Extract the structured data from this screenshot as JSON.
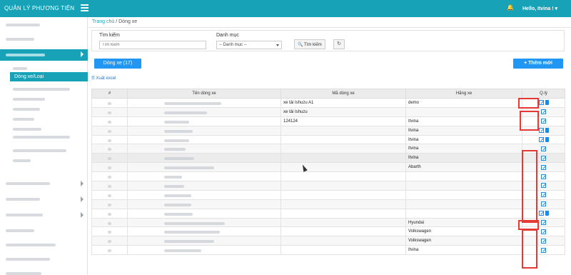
{
  "header": {
    "title": "QUẢN LÝ PHƯƠNG TIỆN",
    "greeting": "Hello, Itvina !"
  },
  "sidebar": {
    "active_sub_label": "Dòng xe/Loại"
  },
  "breadcrumb": {
    "home": "Trang chủ",
    "separator": "/",
    "current": "Dòng xe"
  },
  "filter": {
    "search_label": "Tìm kiếm",
    "search_placeholder": "Tìm kiếm",
    "category_label": "Danh mục",
    "category_selected": "-- Danh mục --",
    "search_button": "Tìm kiếm"
  },
  "toolbar": {
    "tab_label": "Dòng xe (17)",
    "add_button": "+ Thêm mới",
    "export_label": "Xuất excel"
  },
  "table": {
    "headers": [
      "#",
      "Tên dòng xe",
      "Mã dòng xe",
      "Hãng xe",
      "Q.lý"
    ],
    "rows": [
      {
        "code": "xe tải Ishuzu A1",
        "brand": "demo",
        "actions": "edit-delete"
      },
      {
        "code": "xe tải Ishuzu",
        "brand": "",
        "actions": "edit"
      },
      {
        "code": "124124",
        "brand": "Itvina",
        "actions": "edit"
      },
      {
        "code": "",
        "brand": "Itvina",
        "actions": "edit-delete"
      },
      {
        "code": "",
        "brand": "Itvina",
        "actions": "edit-delete"
      },
      {
        "code": "",
        "brand": "Itvina",
        "actions": "edit"
      },
      {
        "code": "",
        "brand": "Itvina",
        "actions": "edit"
      },
      {
        "code": "",
        "brand": "Abarth",
        "actions": "edit"
      },
      {
        "code": "",
        "brand": "",
        "actions": "edit"
      },
      {
        "code": "",
        "brand": "",
        "actions": "edit"
      },
      {
        "code": "",
        "brand": "",
        "actions": "edit"
      },
      {
        "code": "",
        "brand": "",
        "actions": "edit"
      },
      {
        "code": "",
        "brand": "",
        "actions": "edit-delete"
      },
      {
        "code": "",
        "brand": "Hyundai",
        "actions": "edit"
      },
      {
        "code": "",
        "brand": "Volkswagen",
        "actions": "edit"
      },
      {
        "code": "",
        "brand": "Volkswagen",
        "actions": "edit"
      },
      {
        "code": "",
        "brand": "Itvina",
        "actions": "edit"
      }
    ]
  },
  "icons": {
    "menu": "hamburger-icon",
    "bell": "bell-icon",
    "search": "search-icon",
    "refresh": "refresh-icon",
    "export": "file-excel-icon",
    "edit": "edit-icon",
    "delete": "trash-icon"
  },
  "colors": {
    "primary": "#17a2b8",
    "button": "#2196f3",
    "highlight": "#e53935"
  }
}
